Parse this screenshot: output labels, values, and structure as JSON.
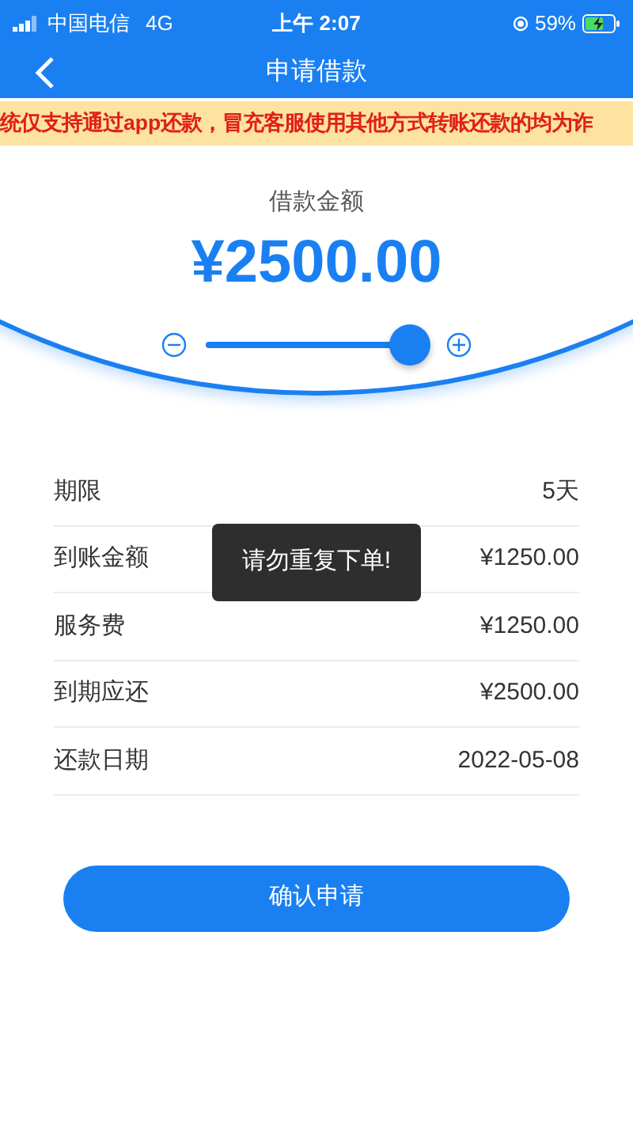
{
  "status_bar": {
    "carrier": "中国电信",
    "network": "4G",
    "time": "上午 2:07",
    "battery": "59%"
  },
  "nav": {
    "title": "申请借款"
  },
  "notice": "统仅支持通过app还款，冒充客服使用其他方式转账还款的均为诈",
  "amount": {
    "label": "借款金额",
    "value": "¥2500.00",
    "level": 1
  },
  "rows": [
    {
      "label": "期限",
      "value": "5天"
    },
    {
      "label": "到账金额",
      "value": "¥1250.00"
    },
    {
      "label": "服务费",
      "value": "¥1250.00"
    },
    {
      "label": "到期应还",
      "value": "¥2500.00"
    },
    {
      "label": "还款日期",
      "value": "2022-05-08"
    }
  ],
  "toast": "请勿重复下单!",
  "submit_button": "确认申请"
}
